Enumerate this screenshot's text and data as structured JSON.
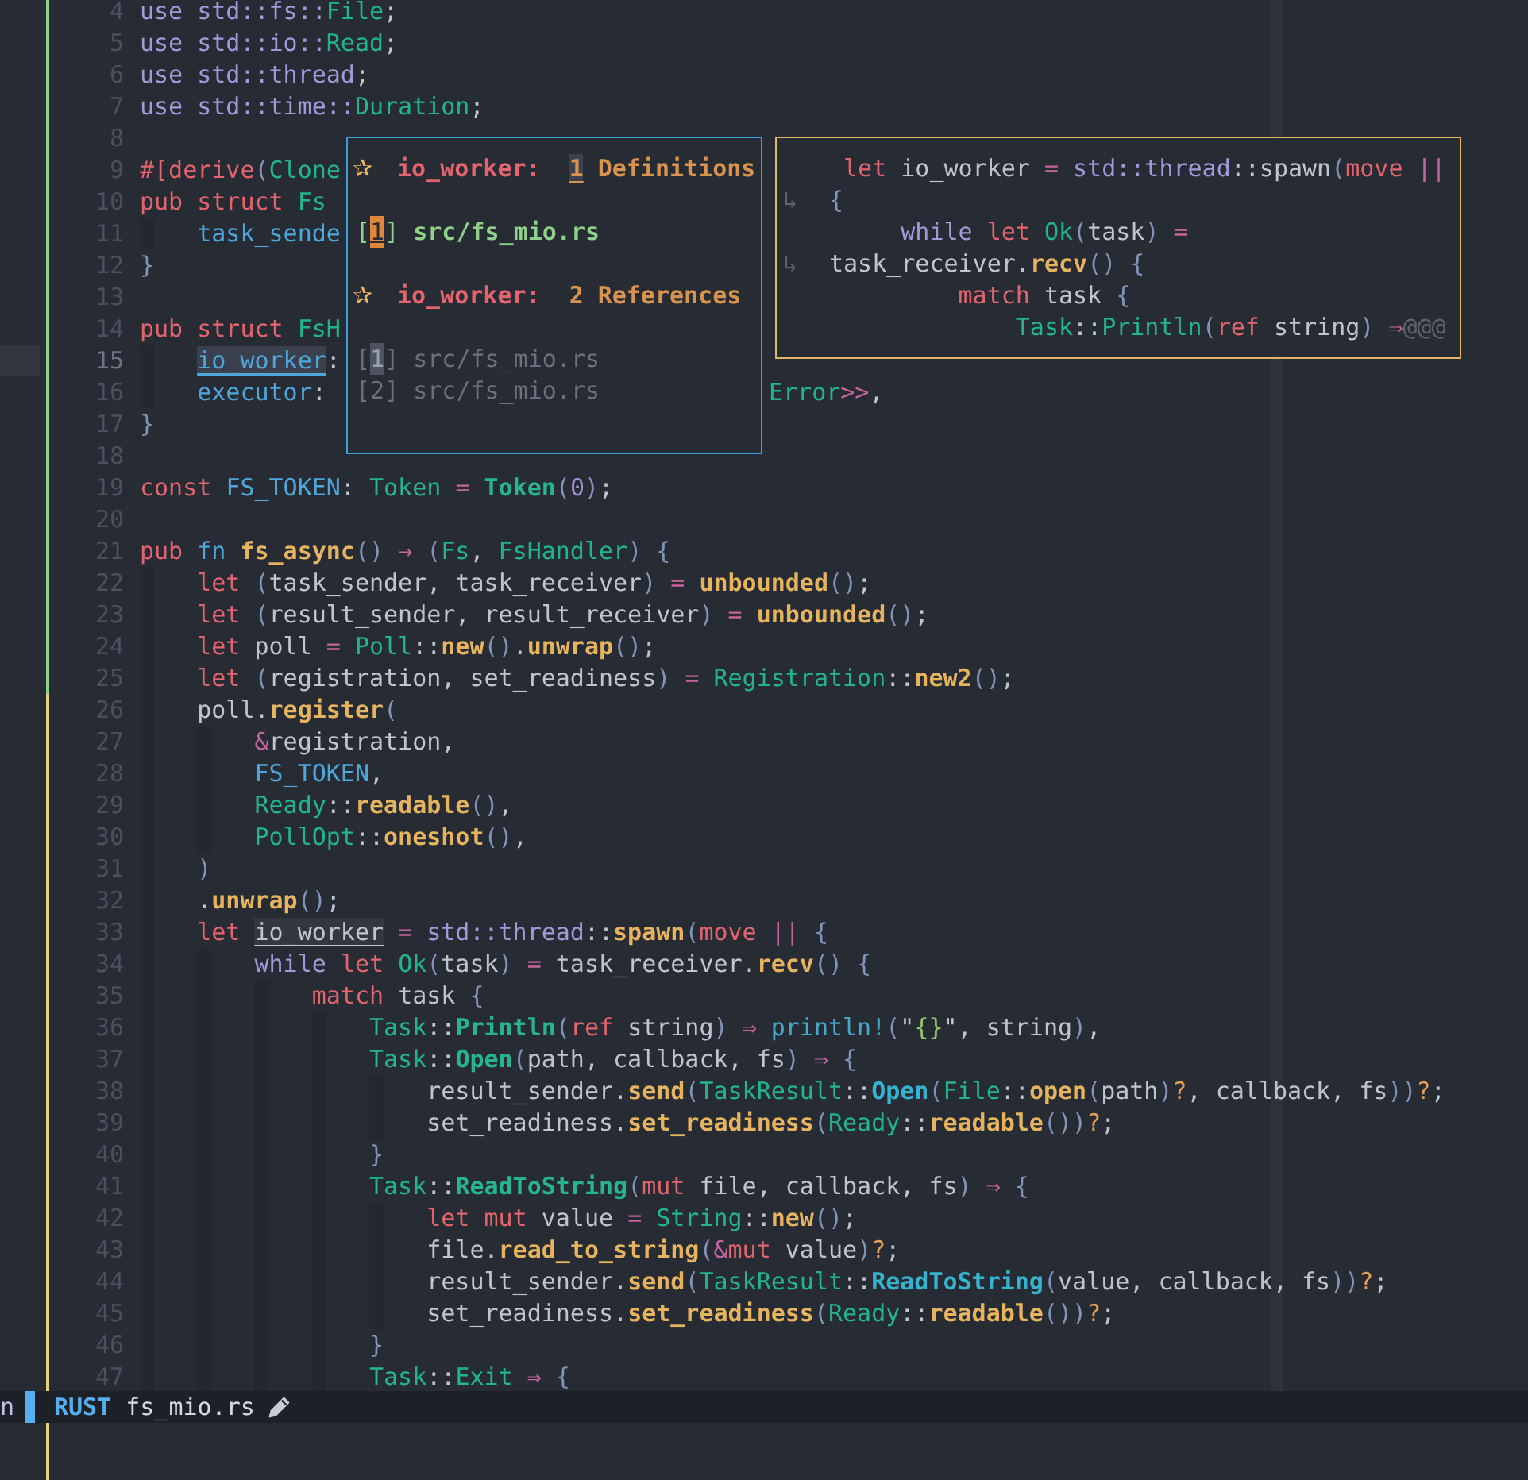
{
  "editor": {
    "lines": [
      {
        "number": "4",
        "color": "#8fd18a",
        "current": false,
        "tokens": [
          {
            "kind": "control",
            "text": "use std::fs::"
          },
          {
            "kind": "type",
            "text": "File"
          },
          {
            "kind": "plain",
            "text": ";"
          }
        ]
      },
      {
        "number": "5",
        "color": "#8fd18a",
        "current": false,
        "tokens": [
          {
            "kind": "control",
            "text": "use std::io::"
          },
          {
            "kind": "type",
            "text": "Read"
          },
          {
            "kind": "plain",
            "text": ";"
          }
        ]
      },
      {
        "number": "6",
        "color": "#8fd18a",
        "current": false,
        "tokens": [
          {
            "kind": "control",
            "text": "use std::thread"
          },
          {
            "kind": "plain",
            "text": ";"
          }
        ]
      },
      {
        "number": "7",
        "color": "#8fd18a",
        "current": false,
        "tokens": [
          {
            "kind": "control",
            "text": "use std::time::"
          },
          {
            "kind": "type",
            "text": "Duration"
          },
          {
            "kind": "plain",
            "text": ";"
          }
        ]
      },
      {
        "number": "8",
        "color": "#8fd18a",
        "current": false
      },
      {
        "number": "9",
        "color": "#8fd18a",
        "current": false,
        "tokens": [
          {
            "kind": "keyword",
            "text": "#[derive"
          },
          {
            "kind": "punct",
            "text": "("
          },
          {
            "kind": "type",
            "text": "Clone"
          }
        ]
      },
      {
        "number": "10",
        "color": "#8fd18a",
        "current": false,
        "tokens": [
          {
            "kind": "keyword",
            "text": "pub struct "
          },
          {
            "kind": "type",
            "text": "Fs"
          }
        ]
      },
      {
        "number": "11",
        "color": "#8fd18a",
        "current": false,
        "tokens": [
          {
            "kind": "field",
            "text": "    task_sende"
          }
        ]
      },
      {
        "number": "12",
        "color": "#8fd18a",
        "current": false,
        "tokens": [
          {
            "kind": "punct",
            "text": "}"
          }
        ]
      },
      {
        "number": "13",
        "color": "#8fd18a",
        "current": false
      },
      {
        "number": "14",
        "color": "#8fd18a",
        "current": false,
        "tokens": [
          {
            "kind": "keyword",
            "text": "pub struct "
          },
          {
            "kind": "type",
            "text": "FsH"
          }
        ]
      },
      {
        "number": "15",
        "color": "#8fd18a",
        "current": true,
        "tokens": [
          {
            "kind": "cursor",
            "text": "    io_worker"
          },
          {
            "kind": "plain",
            "text": ":"
          }
        ]
      },
      {
        "number": "16",
        "color": "#8fd18a",
        "current": false,
        "tokens": [
          {
            "kind": "field",
            "text": "    executor"
          },
          {
            "kind": "plain",
            "text": ":"
          }
        ],
        "tail": [
          {
            "kind": "type",
            "text": "Error"
          },
          {
            "kind": "operator",
            "text": ">>"
          },
          {
            "kind": "plain",
            "text": ","
          }
        ]
      },
      {
        "number": "17",
        "color": "#8fd18a",
        "current": false,
        "tokens": [
          {
            "kind": "punct",
            "text": "}"
          }
        ]
      },
      {
        "number": "18",
        "color": "#8fd18a",
        "current": false
      },
      {
        "number": "19",
        "color": "#8fd18a",
        "current": false,
        "tokens": [
          {
            "kind": "keyword",
            "text": "const "
          },
          {
            "kind": "field",
            "text": "FS_TOKEN"
          },
          {
            "kind": "plain",
            "text": ": "
          },
          {
            "kind": "type",
            "text": "Token"
          },
          {
            "kind": "operator",
            "text": " = "
          },
          {
            "kind": "variant",
            "text": "Token"
          },
          {
            "kind": "punct",
            "text": "("
          },
          {
            "kind": "number",
            "text": "0"
          },
          {
            "kind": "punct",
            "text": ")"
          },
          {
            "kind": "plain",
            "text": ";"
          }
        ]
      },
      {
        "number": "20",
        "color": "#8fd18a",
        "current": false
      },
      {
        "number": "21",
        "color": "#8fd18a",
        "current": false,
        "tokens": [
          {
            "kind": "keyword",
            "text": "pub "
          },
          {
            "kind": "field",
            "text": "fn "
          },
          {
            "kind": "function",
            "text": "fs_async"
          },
          {
            "kind": "punct",
            "text": "() "
          },
          {
            "kind": "operator",
            "text": "→ "
          },
          {
            "kind": "punct",
            "text": "("
          },
          {
            "kind": "type",
            "text": "Fs"
          },
          {
            "kind": "plain",
            "text": ", "
          },
          {
            "kind": "type",
            "text": "FsHandler"
          },
          {
            "kind": "punct",
            "text": ") {"
          }
        ]
      },
      {
        "number": "22",
        "color": "#8fd18a",
        "current": false,
        "tokens": [
          {
            "kind": "keyword",
            "text": "    let "
          },
          {
            "kind": "punct",
            "text": "("
          },
          {
            "kind": "plain",
            "text": "task_sender, task_receiver"
          },
          {
            "kind": "punct",
            "text": ")"
          },
          {
            "kind": "operator",
            "text": " = "
          },
          {
            "kind": "function",
            "text": "unbounded"
          },
          {
            "kind": "punct",
            "text": "()"
          },
          {
            "kind": "plain",
            "text": ";"
          }
        ]
      },
      {
        "number": "23",
        "color": "#8fd18a",
        "current": false,
        "tokens": [
          {
            "kind": "keyword",
            "text": "    let "
          },
          {
            "kind": "punct",
            "text": "("
          },
          {
            "kind": "plain",
            "text": "result_sender, result_receiver"
          },
          {
            "kind": "punct",
            "text": ")"
          },
          {
            "kind": "operator",
            "text": " = "
          },
          {
            "kind": "function",
            "text": "unbounded"
          },
          {
            "kind": "punct",
            "text": "()"
          },
          {
            "kind": "plain",
            "text": ";"
          }
        ]
      },
      {
        "number": "24",
        "color": "#8fd18a",
        "current": false,
        "tokens": [
          {
            "kind": "keyword",
            "text": "    let "
          },
          {
            "kind": "plain",
            "text": "poll "
          },
          {
            "kind": "operator",
            "text": "= "
          },
          {
            "kind": "type",
            "text": "Poll"
          },
          {
            "kind": "plain",
            "text": "::"
          },
          {
            "kind": "function",
            "text": "new"
          },
          {
            "kind": "punct",
            "text": "()"
          },
          {
            "kind": "plain",
            "text": "."
          },
          {
            "kind": "function",
            "text": "unwrap"
          },
          {
            "kind": "punct",
            "text": "()"
          },
          {
            "kind": "plain",
            "text": ";"
          }
        ]
      },
      {
        "number": "25",
        "color": "#8fd18a",
        "current": false,
        "tokens": [
          {
            "kind": "keyword",
            "text": "    let "
          },
          {
            "kind": "punct",
            "text": "("
          },
          {
            "kind": "plain",
            "text": "registration, set_readiness"
          },
          {
            "kind": "punct",
            "text": ")"
          },
          {
            "kind": "operator",
            "text": " = "
          },
          {
            "kind": "type",
            "text": "Registration"
          },
          {
            "kind": "plain",
            "text": "::"
          },
          {
            "kind": "function",
            "text": "new2"
          },
          {
            "kind": "punct",
            "text": "()"
          },
          {
            "kind": "plain",
            "text": ";"
          }
        ]
      },
      {
        "number": "26",
        "color": "#e6d27a",
        "current": false,
        "tokens": [
          {
            "kind": "plain",
            "text": "    poll."
          },
          {
            "kind": "function",
            "text": "register"
          },
          {
            "kind": "punct",
            "text": "("
          }
        ]
      },
      {
        "number": "27",
        "color": "#e6d27a",
        "current": false,
        "tokens": [
          {
            "kind": "operator",
            "text": "        &"
          },
          {
            "kind": "plain",
            "text": "registration,"
          }
        ]
      },
      {
        "number": "28",
        "color": "#e6d27a",
        "current": false,
        "tokens": [
          {
            "kind": "field",
            "text": "        FS_TOKEN"
          },
          {
            "kind": "plain",
            "text": ","
          }
        ]
      },
      {
        "number": "29",
        "color": "#e6d27a",
        "current": false,
        "tokens": [
          {
            "kind": "type",
            "text": "        Ready"
          },
          {
            "kind": "plain",
            "text": "::"
          },
          {
            "kind": "function",
            "text": "readable"
          },
          {
            "kind": "punct",
            "text": "()"
          },
          {
            "kind": "plain",
            "text": ","
          }
        ]
      },
      {
        "number": "30",
        "color": "#e6d27a",
        "current": false,
        "tokens": [
          {
            "kind": "type",
            "text": "        PollOpt"
          },
          {
            "kind": "plain",
            "text": "::"
          },
          {
            "kind": "function",
            "text": "oneshot"
          },
          {
            "kind": "punct",
            "text": "()"
          },
          {
            "kind": "plain",
            "text": ","
          }
        ]
      },
      {
        "number": "31",
        "color": "#e6d27a",
        "current": false,
        "tokens": [
          {
            "kind": "punct",
            "text": "    )"
          }
        ]
      },
      {
        "number": "32",
        "color": "#e6d27a",
        "current": false,
        "tokens": [
          {
            "kind": "plain",
            "text": "    ."
          },
          {
            "kind": "function",
            "text": "unwrap"
          },
          {
            "kind": "punct",
            "text": "()"
          },
          {
            "kind": "plain",
            "text": ";"
          }
        ]
      },
      {
        "number": "33",
        "color": "#e6d27a",
        "current": false,
        "tokens": [
          {
            "kind": "keyword",
            "text": "    let "
          },
          {
            "kind": "reference",
            "text": "io_worker"
          },
          {
            "kind": "operator",
            "text": " = "
          },
          {
            "kind": "control",
            "text": "std::thread"
          },
          {
            "kind": "plain",
            "text": "::"
          },
          {
            "kind": "function",
            "text": "spawn"
          },
          {
            "kind": "punct",
            "text": "("
          },
          {
            "kind": "keyword",
            "text": "move "
          },
          {
            "kind": "operator",
            "text": "|| "
          },
          {
            "kind": "punct",
            "text": "{"
          }
        ]
      },
      {
        "number": "34",
        "color": "#e6d27a",
        "current": false,
        "tokens": [
          {
            "kind": "control",
            "text": "        while "
          },
          {
            "kind": "keyword",
            "text": "let "
          },
          {
            "kind": "type",
            "text": "Ok"
          },
          {
            "kind": "punct",
            "text": "("
          },
          {
            "kind": "plain",
            "text": "task"
          },
          {
            "kind": "punct",
            "text": ")"
          },
          {
            "kind": "operator",
            "text": " = "
          },
          {
            "kind": "plain",
            "text": "task_receiver."
          },
          {
            "kind": "function",
            "text": "recv"
          },
          {
            "kind": "punct",
            "text": "() {"
          }
        ]
      },
      {
        "number": "35",
        "color": "#e6d27a",
        "current": false,
        "tokens": [
          {
            "kind": "keyword",
            "text": "            match "
          },
          {
            "kind": "plain",
            "text": "task "
          },
          {
            "kind": "punct",
            "text": "{"
          }
        ]
      },
      {
        "number": "36",
        "color": "#e6d27a",
        "current": false,
        "tokens": [
          {
            "kind": "type",
            "text": "                Task"
          },
          {
            "kind": "plain",
            "text": "::"
          },
          {
            "kind": "variant",
            "text": "Println"
          },
          {
            "kind": "punct",
            "text": "("
          },
          {
            "kind": "keyword",
            "text": "ref "
          },
          {
            "kind": "plain",
            "text": "string"
          },
          {
            "kind": "punct",
            "text": ")"
          },
          {
            "kind": "operator",
            "text": " ⇒ "
          },
          {
            "kind": "macro",
            "text": "println!"
          },
          {
            "kind": "punct",
            "text": "("
          },
          {
            "kind": "plain",
            "text": "\""
          },
          {
            "kind": "string",
            "text": "{}"
          },
          {
            "kind": "plain",
            "text": "\", string"
          },
          {
            "kind": "punct",
            "text": ")"
          },
          {
            "kind": "plain",
            "text": ","
          }
        ]
      },
      {
        "number": "37",
        "color": "#e6d27a",
        "current": false,
        "tokens": [
          {
            "kind": "type",
            "text": "                Task"
          },
          {
            "kind": "plain",
            "text": "::"
          },
          {
            "kind": "variant",
            "text": "Open"
          },
          {
            "kind": "punct",
            "text": "("
          },
          {
            "kind": "plain",
            "text": "path, callback, fs"
          },
          {
            "kind": "punct",
            "text": ")"
          },
          {
            "kind": "operator",
            "text": " ⇒ "
          },
          {
            "kind": "punct",
            "text": "{"
          }
        ]
      },
      {
        "number": "38",
        "color": "#e6d27a",
        "current": false,
        "tokens": [
          {
            "kind": "plain",
            "text": "                    result_sender."
          },
          {
            "kind": "function",
            "text": "send"
          },
          {
            "kind": "punct",
            "text": "("
          },
          {
            "kind": "type",
            "text": "TaskResult"
          },
          {
            "kind": "plain",
            "text": "::"
          },
          {
            "kind": "ctor",
            "text": "Open"
          },
          {
            "kind": "punct",
            "text": "("
          },
          {
            "kind": "type",
            "text": "File"
          },
          {
            "kind": "plain",
            "text": "::"
          },
          {
            "kind": "function",
            "text": "open"
          },
          {
            "kind": "punct",
            "text": "("
          },
          {
            "kind": "plain",
            "text": "path"
          },
          {
            "kind": "punct",
            "text": ")"
          },
          {
            "kind": "try",
            "text": "?"
          },
          {
            "kind": "plain",
            "text": ", callback, fs"
          },
          {
            "kind": "punct",
            "text": "))"
          },
          {
            "kind": "try",
            "text": "?"
          },
          {
            "kind": "plain",
            "text": ";"
          }
        ]
      },
      {
        "number": "39",
        "color": "#e6d27a",
        "current": false,
        "tokens": [
          {
            "kind": "plain",
            "text": "                    set_readiness."
          },
          {
            "kind": "function",
            "text": "set_readiness"
          },
          {
            "kind": "punct",
            "text": "("
          },
          {
            "kind": "type",
            "text": "Ready"
          },
          {
            "kind": "plain",
            "text": "::"
          },
          {
            "kind": "function",
            "text": "readable"
          },
          {
            "kind": "punct",
            "text": "())"
          },
          {
            "kind": "try",
            "text": "?"
          },
          {
            "kind": "plain",
            "text": ";"
          }
        ]
      },
      {
        "number": "40",
        "color": "#e6d27a",
        "current": false,
        "tokens": [
          {
            "kind": "punct",
            "text": "                }"
          }
        ]
      },
      {
        "number": "41",
        "color": "#e6d27a",
        "current": false,
        "tokens": [
          {
            "kind": "type",
            "text": "                Task"
          },
          {
            "kind": "plain",
            "text": "::"
          },
          {
            "kind": "variant",
            "text": "ReadToString"
          },
          {
            "kind": "punct",
            "text": "("
          },
          {
            "kind": "keyword",
            "text": "mut "
          },
          {
            "kind": "plain",
            "text": "file, callback, fs"
          },
          {
            "kind": "punct",
            "text": ")"
          },
          {
            "kind": "operator",
            "text": " ⇒ "
          },
          {
            "kind": "punct",
            "text": "{"
          }
        ]
      },
      {
        "number": "42",
        "color": "#e6d27a",
        "current": false,
        "tokens": [
          {
            "kind": "keyword",
            "text": "                    let mut "
          },
          {
            "kind": "plain",
            "text": "value "
          },
          {
            "kind": "operator",
            "text": "= "
          },
          {
            "kind": "type",
            "text": "String"
          },
          {
            "kind": "plain",
            "text": "::"
          },
          {
            "kind": "function",
            "text": "new"
          },
          {
            "kind": "punct",
            "text": "()"
          },
          {
            "kind": "plain",
            "text": ";"
          }
        ]
      },
      {
        "number": "43",
        "color": "#e6d27a",
        "current": false,
        "tokens": [
          {
            "kind": "plain",
            "text": "                    file."
          },
          {
            "kind": "function",
            "text": "read_to_string"
          },
          {
            "kind": "punct",
            "text": "("
          },
          {
            "kind": "operator",
            "text": "&"
          },
          {
            "kind": "keyword",
            "text": "mut "
          },
          {
            "kind": "plain",
            "text": "value"
          },
          {
            "kind": "punct",
            "text": ")"
          },
          {
            "kind": "try",
            "text": "?"
          },
          {
            "kind": "plain",
            "text": ";"
          }
        ]
      },
      {
        "number": "44",
        "color": "#e6d27a",
        "current": false,
        "tokens": [
          {
            "kind": "plain",
            "text": "                    result_sender."
          },
          {
            "kind": "function",
            "text": "send"
          },
          {
            "kind": "punct",
            "text": "("
          },
          {
            "kind": "type",
            "text": "TaskResult"
          },
          {
            "kind": "plain",
            "text": "::"
          },
          {
            "kind": "ctor",
            "text": "ReadToString"
          },
          {
            "kind": "punct",
            "text": "("
          },
          {
            "kind": "plain",
            "text": "value, callback, fs"
          },
          {
            "kind": "punct",
            "text": "))"
          },
          {
            "kind": "try",
            "text": "?"
          },
          {
            "kind": "plain",
            "text": ";"
          }
        ]
      },
      {
        "number": "45",
        "color": "#e6d27a",
        "current": false,
        "tokens": [
          {
            "kind": "plain",
            "text": "                    set_readiness."
          },
          {
            "kind": "function",
            "text": "set_readiness"
          },
          {
            "kind": "punct",
            "text": "("
          },
          {
            "kind": "type",
            "text": "Ready"
          },
          {
            "kind": "plain",
            "text": "::"
          },
          {
            "kind": "function",
            "text": "readable"
          },
          {
            "kind": "punct",
            "text": "())"
          },
          {
            "kind": "try",
            "text": "?"
          },
          {
            "kind": "plain",
            "text": ";"
          }
        ]
      },
      {
        "number": "46",
        "color": "#e6d27a",
        "current": false,
        "tokens": [
          {
            "kind": "punct",
            "text": "                }"
          }
        ]
      },
      {
        "number": "47",
        "color": "#e6d27a",
        "current": false,
        "tokens": [
          {
            "kind": "type",
            "text": "                Task"
          },
          {
            "kind": "plain",
            "text": "::"
          },
          {
            "kind": "type",
            "text": "Exit"
          },
          {
            "kind": "operator",
            "text": " ⇒ "
          },
          {
            "kind": "punct",
            "text": "{"
          }
        ]
      }
    ]
  },
  "definitions_popup": {
    "sections": [
      {
        "marker": "✰",
        "symbol": "io_worker:",
        "count": "1",
        "label": "Definitions",
        "active": true,
        "entries": [
          {
            "open": "[",
            "index": "1",
            "close": "]",
            "path": "src/fs_mio.rs",
            "selected": true
          }
        ]
      },
      {
        "marker": "✰",
        "symbol": "io_worker:",
        "count": "2",
        "label": "References",
        "active": false,
        "entries": [
          {
            "open": "[",
            "index": "1",
            "close": "]",
            "path": "src/fs_mio.rs",
            "selected": true
          },
          {
            "open": "[",
            "index": "2",
            "close": "]",
            "path": "src/fs_mio.rs",
            "selected": false
          }
        ]
      }
    ]
  },
  "preview_popup": {
    "lines": [
      {
        "tokens": [
          {
            "kind": "keyword",
            "text": " let "
          },
          {
            "kind": "plain",
            "text": "io_worker "
          },
          {
            "kind": "operator",
            "text": "= "
          },
          {
            "kind": "control",
            "text": "std::thread"
          },
          {
            "kind": "plain",
            "text": "::spawn"
          },
          {
            "kind": "punct",
            "text": "("
          },
          {
            "kind": "keyword",
            "text": "move "
          },
          {
            "kind": "operator",
            "text": "||"
          }
        ]
      },
      {
        "continuation": "↳",
        "tokens": [
          {
            "kind": "punct",
            "text": "{"
          }
        ]
      },
      {
        "tokens": [
          {
            "kind": "control",
            "text": "     while "
          },
          {
            "kind": "keyword",
            "text": "let "
          },
          {
            "kind": "type",
            "text": "Ok"
          },
          {
            "kind": "punct",
            "text": "("
          },
          {
            "kind": "plain",
            "text": "task"
          },
          {
            "kind": "punct",
            "text": ")"
          },
          {
            "kind": "operator",
            "text": " ="
          }
        ]
      },
      {
        "continuation": "↳",
        "tokens": [
          {
            "kind": "plain",
            "text": "task_receiver."
          },
          {
            "kind": "function",
            "text": "recv"
          },
          {
            "kind": "punct",
            "text": "() {"
          }
        ]
      },
      {
        "tokens": [
          {
            "kind": "keyword",
            "text": "         match "
          },
          {
            "kind": "plain",
            "text": "task "
          },
          {
            "kind": "punct",
            "text": "{"
          }
        ]
      },
      {
        "tokens": [
          {
            "kind": "type",
            "text": "             Task"
          },
          {
            "kind": "plain",
            "text": "::"
          },
          {
            "kind": "type",
            "text": "Println"
          },
          {
            "kind": "punct",
            "text": "("
          },
          {
            "kind": "keyword",
            "text": "ref "
          },
          {
            "kind": "plain",
            "text": "string"
          },
          {
            "kind": "punct",
            "text": ") "
          },
          {
            "kind": "operator",
            "text": "⇒"
          },
          {
            "kind": "elided",
            "text": "@@@"
          }
        ]
      }
    ]
  },
  "status_bar": {
    "left_fragment": "n",
    "language": "RUST",
    "file": "fs_mio.rs",
    "modified": true
  }
}
